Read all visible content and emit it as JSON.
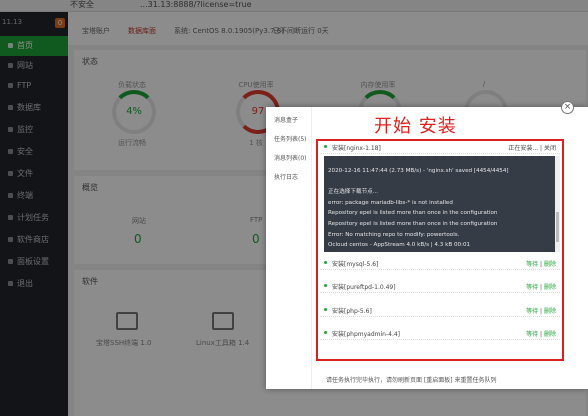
{
  "browser": {
    "security_label": "不安全",
    "url": "...31.13:8888/?license=true"
  },
  "sidebar": {
    "ip": "11.13",
    "badge": "0",
    "items": [
      {
        "label": "首页"
      },
      {
        "label": "网站"
      },
      {
        "label": "FTP"
      },
      {
        "label": "数据库"
      },
      {
        "label": "监控"
      },
      {
        "label": "安全"
      },
      {
        "label": "文件"
      },
      {
        "label": "终端"
      },
      {
        "label": "计划任务"
      },
      {
        "label": "软件商店"
      },
      {
        "label": "面板设置"
      },
      {
        "label": "退出"
      }
    ]
  },
  "topbar": {
    "items": [
      "宝塔账户",
      "数据库面",
      "系统: CentOS 8.0.1905(Py3.7.8)",
      "已不间断运行 0天"
    ]
  },
  "dashboard": {
    "status_title": "状态",
    "gauges": [
      {
        "label": "负载状态",
        "value": "4%",
        "sub": "运行流畅"
      },
      {
        "label": "CPU使用率",
        "value": "97",
        "sub": "1 核"
      },
      {
        "label": "内存使用率",
        "value": "",
        "sub": ""
      },
      {
        "label": "/",
        "value": "",
        "sub": ""
      }
    ],
    "overview_title": "概览",
    "overview": [
      {
        "label": "网站",
        "value": "0"
      },
      {
        "label": "FTP",
        "value": "0"
      }
    ],
    "software_title": "软件",
    "software": [
      {
        "label": "宝塔SSH终端 1.0"
      },
      {
        "label": "Linux工具箱 1.4"
      }
    ]
  },
  "dialog": {
    "tabs": [
      "消息盒子",
      "任务列表(5)",
      "消息列表(0)",
      "执行日志"
    ],
    "headline": "开始 安装",
    "close_label": "×",
    "tasks": [
      {
        "name": "安装[nginx-1.18]",
        "status": "正在安装...",
        "action": "关闭"
      },
      {
        "name": "安装[mysql-5.6]",
        "status": "等待",
        "action": "删除"
      },
      {
        "name": "安装[pureftpd-1.0.49]",
        "status": "等待",
        "action": "删除"
      },
      {
        "name": "安装[php-5.6]",
        "status": "等待",
        "action": "删除"
      },
      {
        "name": "安装[phpmyadmin-4.4]",
        "status": "等待",
        "action": "删除"
      }
    ],
    "log_lines": [
      "2020-12-16 11:47:44 (2.73 MB/s) - 'nginx.sh' saved [4454/4454]",
      "",
      "正在选择下载节点...",
      "error: package mariadb-libs-* is not installed",
      "Repository epel is listed more than once in the configuration",
      "Repository epel is listed more than once in the configuration",
      "Error: No matching repo to modify: powertools.",
      "Ocloud centos - AppStream 4.0 kB/s | 4.3 kB 00:01"
    ],
    "footnote": "请任务执行完毕执行，请勿刷新页面 [重启面板] 来重置任务队列"
  }
}
